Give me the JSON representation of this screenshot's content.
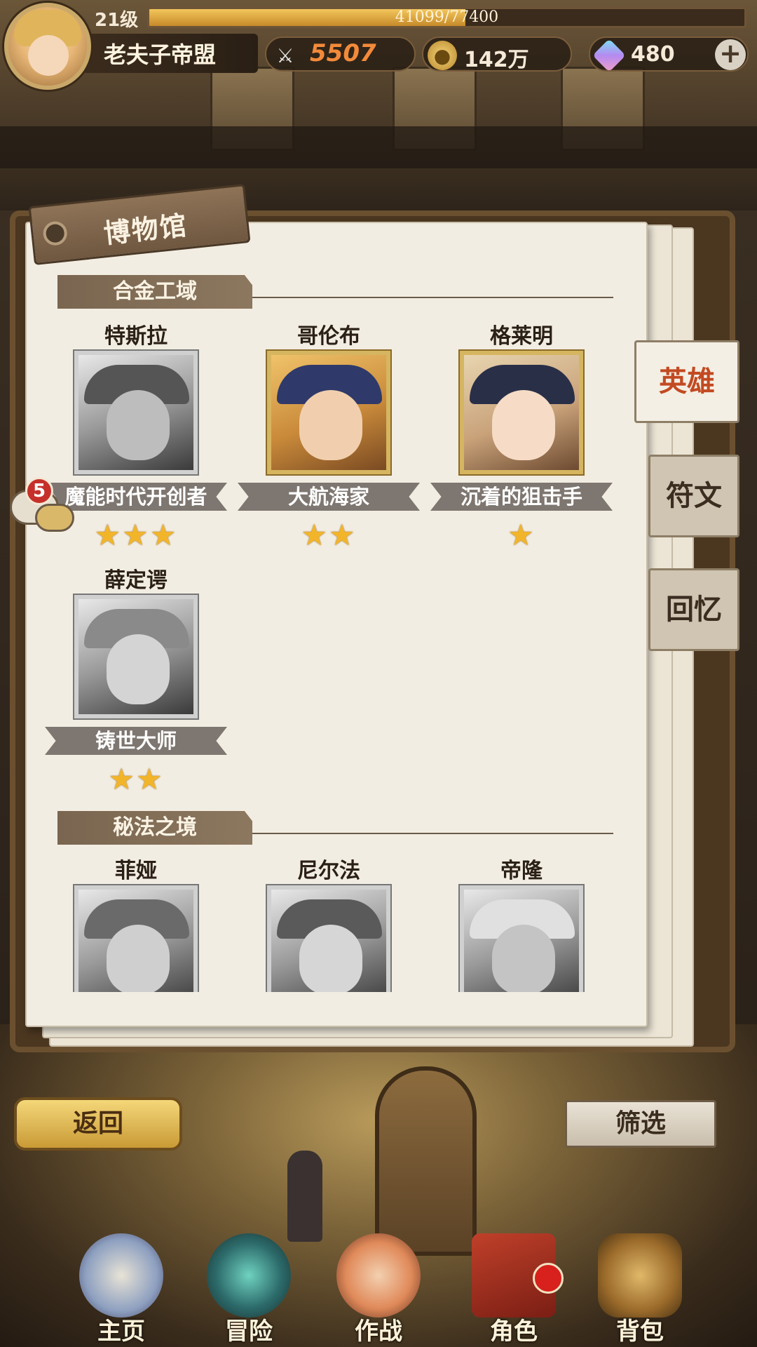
{
  "player": {
    "level": "21级",
    "xp_text": "41099/77400",
    "xp_fraction": 0.531,
    "name": "老夫子帝盟",
    "power": "5507",
    "gold": "142万",
    "gems": "480"
  },
  "panel": {
    "title": "博物馆",
    "sections": [
      {
        "title": "合金工域",
        "heroes": [
          {
            "name": "特斯拉",
            "title": "魔能时代开创者",
            "stars": "★★★",
            "owned": false
          },
          {
            "name": "哥伦布",
            "title": "大航海家",
            "stars": "★★",
            "owned": true
          },
          {
            "name": "格莱明",
            "title": "沉着的狙击手",
            "stars": "★",
            "owned": true
          },
          {
            "name": "薛定谔",
            "title": "铸世大师",
            "stars": "★★",
            "owned": false
          }
        ]
      },
      {
        "title": "秘法之境",
        "heroes": [
          {
            "name": "菲娅"
          },
          {
            "name": "尼尔法"
          },
          {
            "name": "帝隆"
          }
        ]
      }
    ]
  },
  "side_tabs": [
    "英雄",
    "符文",
    "回忆"
  ],
  "chat": {
    "badge": "5"
  },
  "buttons": {
    "back": "返回",
    "filter": "筛选"
  },
  "nav": [
    "主页",
    "冒险",
    "作战",
    "角色",
    "背包"
  ],
  "icons": {
    "avatar": "player-avatar",
    "power": "crossed-swords-icon",
    "gold": "gold-coin-icon",
    "gems": "crystal-gem-icon",
    "plus": "plus-icon"
  },
  "colors": {
    "active_tab": "#c24a22",
    "gold_button": "#e8c25a",
    "star": "#f2b52a",
    "badge_red": "#c6302a"
  }
}
